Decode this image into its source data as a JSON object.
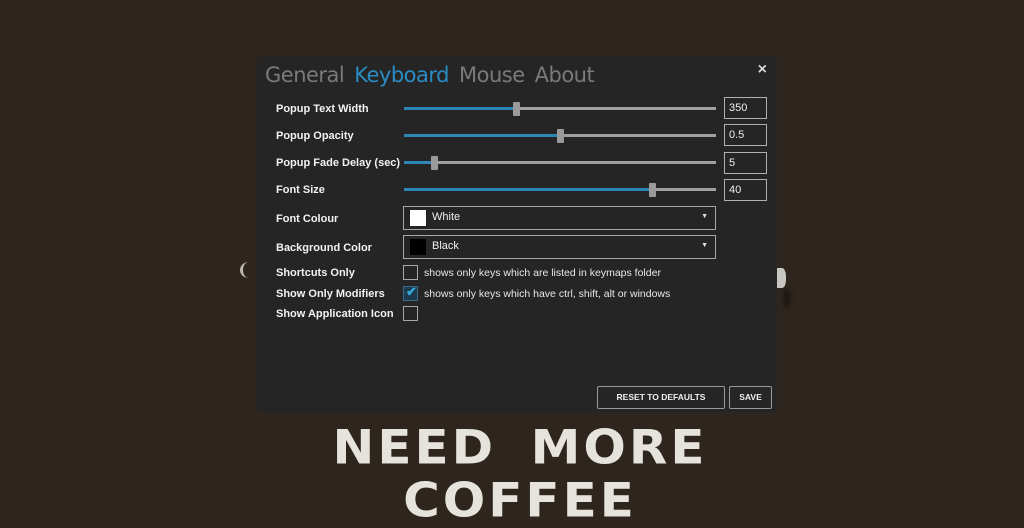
{
  "tabs": [
    {
      "label": "General",
      "active": false
    },
    {
      "label": "Keyboard",
      "active": true
    },
    {
      "label": "Mouse",
      "active": false
    },
    {
      "label": "About",
      "active": false
    }
  ],
  "close_label": "×",
  "sliders": [
    {
      "label": "Popup Text Width",
      "value": "350",
      "fraction": 0.36
    },
    {
      "label": "Popup Opacity",
      "value": "0.5",
      "fraction": 0.5
    },
    {
      "label": "Popup Fade Delay (sec)",
      "value": "5",
      "fraction": 0.095
    },
    {
      "label": "Font Size",
      "value": "40",
      "fraction": 0.795
    }
  ],
  "combos": [
    {
      "label": "Font Colour",
      "value": "White",
      "swatch": "#ffffff",
      "arrow": "▼"
    },
    {
      "label": "Background Color",
      "value": "Black",
      "swatch": "#000000",
      "arrow": "▼"
    }
  ],
  "checks": [
    {
      "label": "Shortcuts Only",
      "checked": false,
      "desc": "shows only keys which are listed in keymaps folder"
    },
    {
      "label": "Show Only Modifiers",
      "checked": true,
      "desc": "shows only keys which have ctrl, shift, alt or windows",
      "tick": "✔"
    },
    {
      "label": "Show Application Icon",
      "checked": false,
      "desc": ""
    }
  ],
  "buttons": {
    "reset": "RESET TO DEFAULTS",
    "save": "SAVE"
  },
  "banner": "NEED MORE COFFEE",
  "colors": {
    "accent": "#2b8cc4",
    "dialog_bg": "#252525",
    "page_bg": "#2e251e"
  }
}
